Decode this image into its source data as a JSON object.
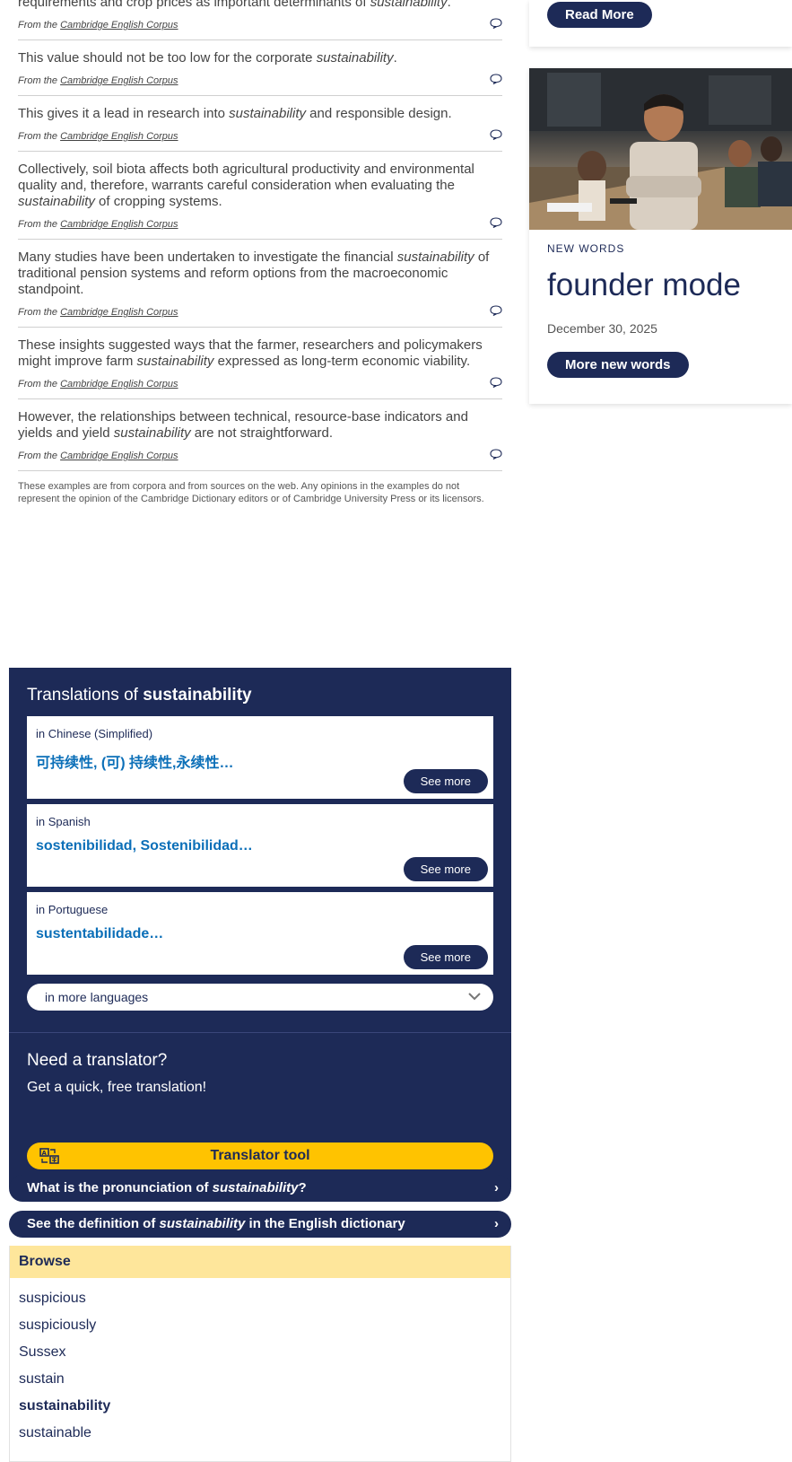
{
  "examples": [
    {
      "before": "requirements and crop prices as important determinants of ",
      "term": "sustainability",
      "after": ".",
      "source_prefix": "From the ",
      "source": "Cambridge English Corpus"
    },
    {
      "before": "This value should not be too low for the corporate ",
      "term": "sustainability",
      "after": ".",
      "source_prefix": "From the ",
      "source": "Cambridge English Corpus"
    },
    {
      "before": "This gives it a lead in research into ",
      "term": "sustainability",
      "after": " and responsible design.",
      "source_prefix": "From the ",
      "source": "Cambridge English Corpus"
    },
    {
      "before": "Collectively, soil biota affects both agricultural productivity and environmental quality and, therefore, warrants careful consideration when evaluating the ",
      "term": "sustainability",
      "after": " of cropping systems.",
      "source_prefix": "From the ",
      "source": "Cambridge English Corpus"
    },
    {
      "before": "Many studies have been undertaken to investigate the financial ",
      "term": "sustainability",
      "after": " of traditional pension systems and reform options from the macroeconomic standpoint.",
      "source_prefix": "From the ",
      "source": "Cambridge English Corpus"
    },
    {
      "before": "These insights suggested ways that the farmer, researchers and policymakers might improve farm ",
      "term": "sustainability",
      "after": " expressed as long-term economic viability.",
      "source_prefix": "From the ",
      "source": "Cambridge English Corpus"
    },
    {
      "before": "However, the relationships between technical, resource-base indicators and yields and yield ",
      "term": "sustainability",
      "after": " are not straightforward.",
      "source_prefix": "From the ",
      "source": "Cambridge English Corpus"
    }
  ],
  "disclaimer": "These examples are from corpora and from sources on the web. Any opinions in the examples do not represent the opinion of the Cambridge Dictionary editors or of Cambridge University Press or its licensors.",
  "sidebar": {
    "read_more": "Read More",
    "new_words_label": "NEW WORDS",
    "new_word": "founder mode",
    "date": "December 30, 2025",
    "more_new_words": "More new words"
  },
  "translations": {
    "title_prefix": "Translations of ",
    "term": "sustainability",
    "items": [
      {
        "lang": "in Chinese (Simplified)",
        "words": "可持续性, (可) 持续性,永续性…",
        "see_more": "See more"
      },
      {
        "lang": "in Spanish",
        "words": "sostenibilidad, Sostenibilidad…",
        "see_more": "See more"
      },
      {
        "lang": "in Portuguese",
        "words": "sustentabilidade…",
        "see_more": "See more"
      }
    ],
    "more_languages": "in more languages",
    "need_title": "Need a translator?",
    "need_text": "Get a quick, free translation!",
    "tool_label": "Translator tool"
  },
  "nav": {
    "pron_prefix": "What is the pronunciation of ",
    "pron_term": "sustainability",
    "pron_suffix": "?",
    "def_prefix": "See the definition of ",
    "def_term": "sustainability",
    "def_suffix": " in the English dictionary"
  },
  "browse": {
    "title": "Browse",
    "items": [
      "suspicious",
      "suspiciously",
      "Sussex",
      "sustain",
      "sustainability",
      "sustainable"
    ],
    "current_index": 4
  },
  "colors": {
    "navy": "#1d2a57",
    "yellow": "#ffc300",
    "browse_header": "#fee69b",
    "link_blue": "#0b6fb8"
  }
}
